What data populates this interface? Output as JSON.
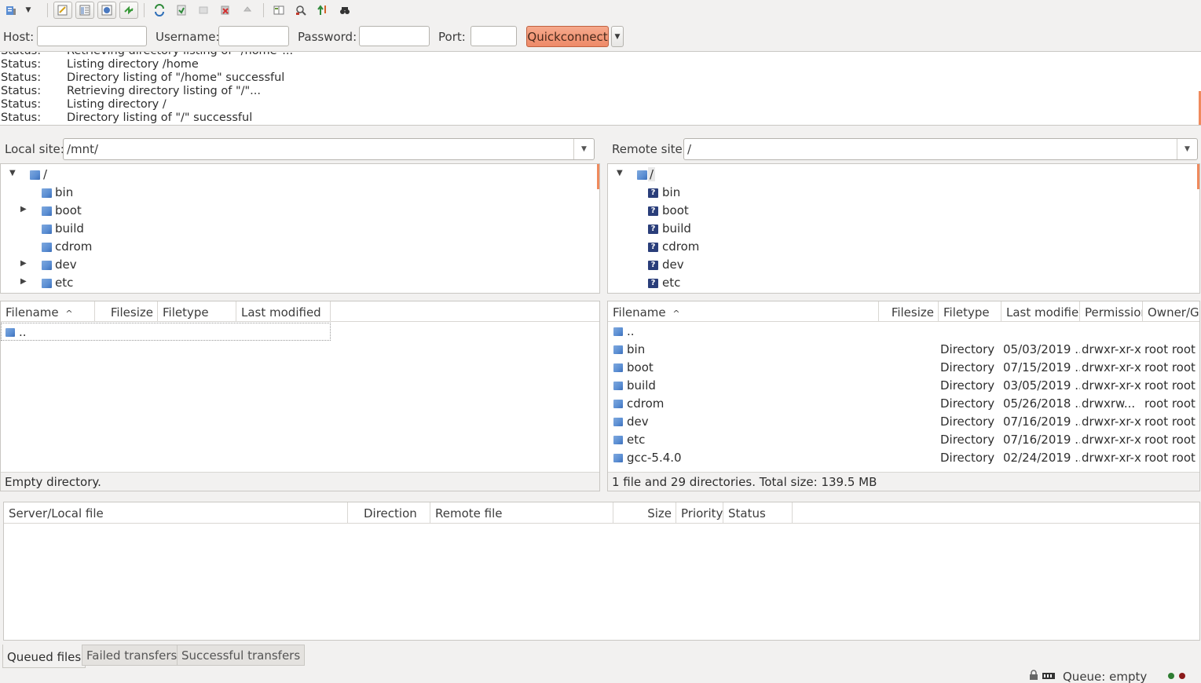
{
  "toolbar": {
    "icons": [
      "site-manager-icon",
      "site-manager-dropdown-icon",
      "toggle-message-log-icon",
      "toggle-local-tree-icon",
      "toggle-remote-tree-icon",
      "toggle-queue-icon",
      "refresh-icon",
      "process-queue-icon",
      "cancel-operation-icon",
      "disconnect-icon",
      "reconnect-icon",
      "directory-comparison-icon",
      "filename-filter-icon",
      "sync-browsing-icon",
      "search-icon"
    ]
  },
  "quickconnect": {
    "host_label": "Host:",
    "host_value": "",
    "username_label": "Username:",
    "username_value": "",
    "password_label": "Password:",
    "password_value": "",
    "port_label": "Port:",
    "port_value": "",
    "button_label": "Quickconnect"
  },
  "log": [
    {
      "key": "Status:",
      "value": "Retrieving directory listing of \"/home\"..."
    },
    {
      "key": "Status:",
      "value": "Listing directory /home"
    },
    {
      "key": "Status:",
      "value": "Directory listing of \"/home\" successful"
    },
    {
      "key": "Status:",
      "value": "Retrieving directory listing of \"/\"..."
    },
    {
      "key": "Status:",
      "value": "Listing directory /"
    },
    {
      "key": "Status:",
      "value": "Directory listing of \"/\" successful"
    }
  ],
  "local": {
    "site_label": "Local site:",
    "path": "/mnt/",
    "tree": [
      {
        "name": "/",
        "expander": "▼"
      },
      {
        "name": "bin",
        "expander": ""
      },
      {
        "name": "boot",
        "expander": "▶"
      },
      {
        "name": "build",
        "expander": ""
      },
      {
        "name": "cdrom",
        "expander": ""
      },
      {
        "name": "dev",
        "expander": "▶"
      },
      {
        "name": "etc",
        "expander": "▶"
      }
    ],
    "columns": [
      "Filename",
      "Filesize",
      "Filetype",
      "Last modified"
    ],
    "sort_indicator": "^",
    "rows": [
      {
        "name": ".."
      }
    ],
    "status": "Empty directory."
  },
  "remote": {
    "site_label": "Remote site:",
    "path": "/",
    "tree": [
      {
        "name": "/",
        "expander": "▼"
      },
      {
        "name": "bin",
        "expander": ""
      },
      {
        "name": "boot",
        "expander": ""
      },
      {
        "name": "build",
        "expander": ""
      },
      {
        "name": "cdrom",
        "expander": ""
      },
      {
        "name": "dev",
        "expander": ""
      },
      {
        "name": "etc",
        "expander": ""
      }
    ],
    "unknown_marker": "?",
    "columns": [
      "Filename",
      "Filesize",
      "Filetype",
      "Last modified",
      "Permission",
      "Owner/Gr"
    ],
    "sort_indicator": "^",
    "rows": [
      {
        "name": "..",
        "size": "",
        "type": "",
        "modified": "",
        "perms": "",
        "owner": ""
      },
      {
        "name": "bin",
        "size": "",
        "type": "Directory",
        "modified": "05/03/2019 ...",
        "perms": "drwxr-xr-x",
        "owner": "root root"
      },
      {
        "name": "boot",
        "size": "",
        "type": "Directory",
        "modified": "07/15/2019 ...",
        "perms": "drwxr-xr-x",
        "owner": "root root"
      },
      {
        "name": "build",
        "size": "",
        "type": "Directory",
        "modified": "03/05/2019 ...",
        "perms": "drwxr-xr-x",
        "owner": "root root"
      },
      {
        "name": "cdrom",
        "size": "",
        "type": "Directory",
        "modified": "05/26/2018 ...",
        "perms": "drwxrw...",
        "owner": "root root"
      },
      {
        "name": "dev",
        "size": "",
        "type": "Directory",
        "modified": "07/16/2019 ...",
        "perms": "drwxr-xr-x",
        "owner": "root root"
      },
      {
        "name": "etc",
        "size": "",
        "type": "Directory",
        "modified": "07/16/2019 ...",
        "perms": "drwxr-xr-x",
        "owner": "root root"
      },
      {
        "name": "gcc-5.4.0",
        "size": "",
        "type": "Directory",
        "modified": "02/24/2019 ...",
        "perms": "drwxr-xr-x",
        "owner": "root root"
      }
    ],
    "status": "1 file and 29 directories. Total size: 139.5 MB"
  },
  "queue": {
    "columns": [
      "Server/Local file",
      "Direction",
      "Remote file",
      "Size",
      "Priority",
      "Status"
    ]
  },
  "tabs": [
    "Queued files",
    "Failed transfers",
    "Successful transfers"
  ],
  "statusbar": {
    "queue_text": "Queue: empty"
  },
  "colors": {
    "accent": "#f08a5d",
    "quickconnect": "#ee8a68",
    "folder": "#5b8ed3"
  }
}
